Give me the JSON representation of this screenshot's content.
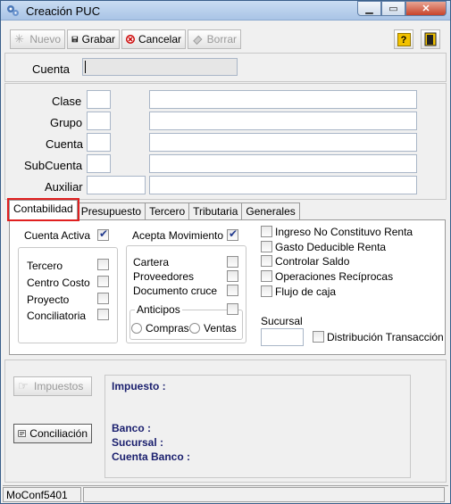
{
  "window": {
    "title": "Creación PUC"
  },
  "toolbar": {
    "nuevo": "Nuevo",
    "grabar": "Grabar",
    "cancelar": "Cancelar",
    "borrar": "Borrar"
  },
  "cuenta_top": {
    "label": "Cuenta",
    "value": ""
  },
  "fields": {
    "clase": "Clase",
    "grupo": "Grupo",
    "cuenta": "Cuenta",
    "subcuenta": "SubCuenta",
    "auxiliar": "Auxiliar"
  },
  "tabs": [
    "Contabilidad",
    "Presupuesto",
    "Tercero",
    "Tributaria",
    "Generales"
  ],
  "contabilidad": {
    "cuenta_activa": "Cuenta Activa",
    "acepta_movimiento": "Acepta Movimiento",
    "left_group": [
      "Tercero",
      "Centro Costo",
      "Proyecto",
      "Conciliatoria"
    ],
    "mid_group": [
      "Cartera",
      "Proveedores",
      "Documento cruce"
    ],
    "anticipos": "Anticipos",
    "compras": "Compras",
    "ventas": "Ventas",
    "right_checks": [
      "Ingreso No Constituvo Renta",
      "Gasto Deducible Renta",
      "Controlar Saldo",
      "Operaciones Recíprocas",
      "Flujo de caja"
    ],
    "sucursal": "Sucursal",
    "distribucion": "Distribución Transacción"
  },
  "bottom": {
    "impuestos_btn": "Impuestos",
    "conciliacion_btn": "Conciliación",
    "impuesto": "Impuesto :",
    "banco": "Banco :",
    "sucursal": "Sucursal :",
    "cuenta_banco": "Cuenta Banco :"
  },
  "statusbar": {
    "code": "MoConf5401"
  }
}
